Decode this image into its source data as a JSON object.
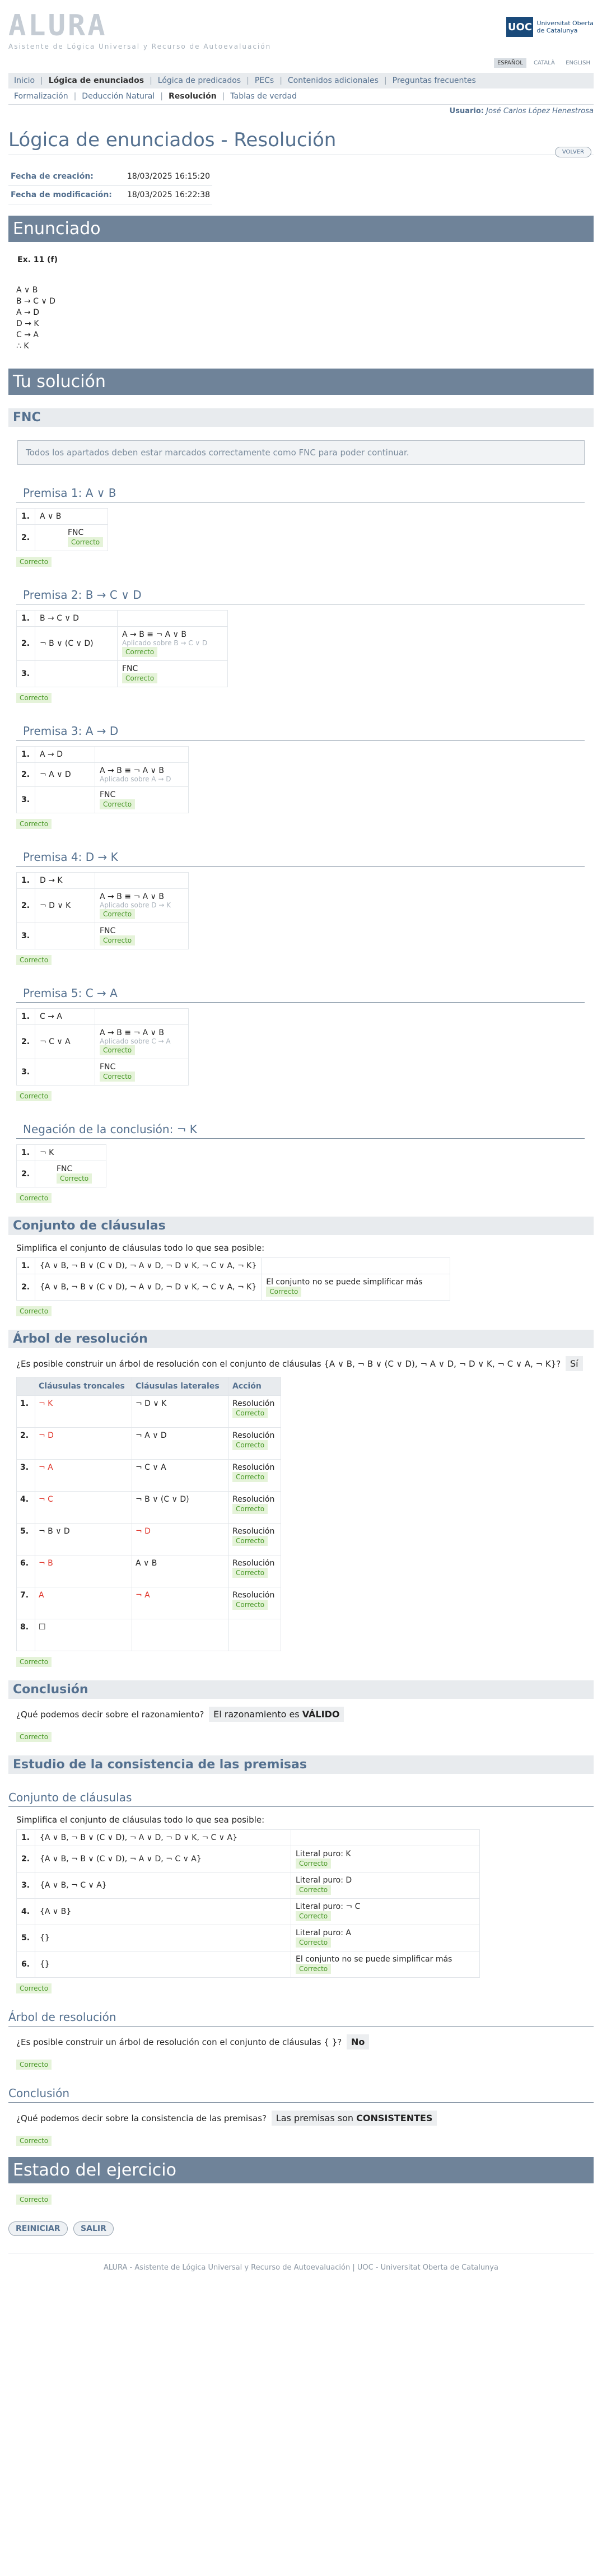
{
  "header": {
    "logo": "ALURA",
    "tagline": "Asistente de Lógica Universal y Recurso de Autoevaluación",
    "uoc_short": "UOC",
    "uoc_line1": "Universitat Oberta",
    "uoc_line2": "de Catalunya",
    "langs": [
      "ESPAÑOL",
      "CATALÀ",
      "ENGLISH"
    ]
  },
  "menu": [
    "Inicio",
    "Lógica de enunciados",
    "Lógica de predicados",
    "PECs",
    "Contenidos adicionales",
    "Preguntas frecuentes"
  ],
  "submenu": [
    "Formalización",
    "Deducción Natural",
    "Resolución",
    "Tablas de verdad"
  ],
  "user_label": "Usuario:",
  "user_name": "José Carlos López Henestrosa",
  "page_title": "Lógica de enunciados - Resolución",
  "volver": "VOLVER",
  "info": {
    "created_label": "Fecha de creación:",
    "created": "18/03/2025 16:15:20",
    "modified_label": "Fecha de modificación:",
    "modified": "18/03/2025 16:22:38"
  },
  "enunciado": {
    "title": "Enunciado",
    "ex": "Ex. 11 (f)",
    "premises": [
      "A ∨ B",
      "B → C ∨ D",
      "A → D",
      "D → K",
      "C → A"
    ],
    "conclusion": "∴ K"
  },
  "solucion_title": "Tu solución",
  "fnc": {
    "title": "FNC",
    "note": "Todos los apartados deben estar marcados correctamente como FNC para poder continuar.",
    "ok": "Correcto",
    "premise1": {
      "title": "Premisa 1: A ∨ B",
      "r1": "A ∨ B",
      "r2": "FNC"
    },
    "premise2": {
      "title": "Premisa 2: B → C ∨ D",
      "r1": "B → C ∨ D",
      "r2": "¬ B ∨ (C ∨ D)",
      "rule": "A → B ≡ ¬ A ∨ B",
      "applied": "Aplicado sobre B → C ∨ D",
      "r3": "FNC"
    },
    "premise3": {
      "title": "Premisa 3: A → D",
      "r1": "A → D",
      "r2": "¬ A ∨ D",
      "rule": "A → B ≡ ¬ A ∨ B",
      "applied": "Aplicado sobre A → D",
      "r3": "FNC"
    },
    "premise4": {
      "title": "Premisa 4: D → K",
      "r1": "D → K",
      "r2": "¬ D ∨ K",
      "rule": "A → B ≡ ¬ A ∨ B",
      "applied": "Aplicado sobre D → K",
      "r3": "FNC"
    },
    "premise5": {
      "title": "Premisa 5: C → A",
      "r1": "C → A",
      "r2": "¬ C ∨ A",
      "rule": "A → B ≡ ¬ A ∨ B",
      "applied": "Aplicado sobre C → A",
      "r3": "FNC"
    },
    "negation": {
      "title": "Negación de la conclusión: ¬ K",
      "r1": "¬ K",
      "r2": "FNC"
    }
  },
  "clausulas": {
    "title": "Conjunto de cláusulas",
    "text": "Simplifica el conjunto de cláusulas todo lo que sea posible:",
    "r1": "{A ∨ B, ¬ B ∨ (C ∨ D), ¬ A ∨ D, ¬ D ∨ K, ¬ C ∨ A, ¬ K}",
    "r2": "{A ∨ B, ¬ B ∨ (C ∨ D), ¬ A ∨ D, ¬ D ∨ K, ¬ C ∨ A, ¬ K}",
    "r2_note": "El conjunto no se puede simplificar más",
    "ok": "Correcto"
  },
  "arbol": {
    "title": "Árbol de resolución",
    "question": "¿Es posible construir un árbol de resolución con el conjunto de cláusulas {A ∨ B, ¬ B ∨ (C ∨ D), ¬ A ∨ D, ¬ D ∨ K, ¬ C ∨ A, ¬ K}?",
    "answer": "Sí",
    "headers": [
      "Cláusulas troncales",
      "Cláusulas laterales",
      "Acción"
    ],
    "rows": [
      {
        "n": "1.",
        "t": "¬ K",
        "l": "¬ D ∨ K",
        "a": "Resolución"
      },
      {
        "n": "2.",
        "t": "¬ D",
        "l": "¬ A ∨ D",
        "a": "Resolución"
      },
      {
        "n": "3.",
        "t": "¬ A",
        "l": "¬ C ∨ A",
        "a": "Resolución"
      },
      {
        "n": "4.",
        "t": "¬ C",
        "l": "¬ B ∨ (C ∨ D)",
        "a": "Resolución"
      },
      {
        "n": "5.",
        "t": "¬ B ∨ D",
        "l": "¬ D",
        "a": "Resolución"
      },
      {
        "n": "6.",
        "t": "¬ B",
        "l": "A ∨ B",
        "a": "Resolución"
      },
      {
        "n": "7.",
        "t": "A",
        "l": "¬ A",
        "a": "Resolución"
      },
      {
        "n": "8.",
        "t": "☐",
        "l": "",
        "a": ""
      }
    ],
    "ok": "Correcto"
  },
  "conclusion": {
    "title": "Conclusión",
    "question": "¿Qué podemos decir sobre el razonamiento?",
    "answer_pre": "El razonamiento es",
    "answer_bold": "VÁLIDO",
    "ok": "Correcto"
  },
  "consistencia": {
    "title": "Estudio de la consistencia de las premisas",
    "clausulas_title": "Conjunto de cláusulas",
    "text": "Simplifica el conjunto de cláusulas todo lo que sea posible:",
    "rows": [
      {
        "n": "1.",
        "v": "{A ∨ B, ¬ B ∨ (C ∨ D), ¬ A ∨ D, ¬ D ∨ K, ¬ C ∨ A}",
        "note": ""
      },
      {
        "n": "2.",
        "v": "{A ∨ B, ¬ B ∨ (C ∨ D), ¬ A ∨ D, ¬ C ∨ A}",
        "note": "Literal puro: K"
      },
      {
        "n": "3.",
        "v": "{A ∨ B, ¬ C ∨ A}",
        "note": "Literal puro: D"
      },
      {
        "n": "4.",
        "v": "{A ∨ B}",
        "note": "Literal puro: ¬ C"
      },
      {
        "n": "5.",
        "v": "{}",
        "note": "Literal puro: A"
      },
      {
        "n": "6.",
        "v": "{}",
        "note": "El conjunto no se puede simplificar más"
      }
    ],
    "ok": "Correcto",
    "arbol_title": "Árbol de resolución",
    "arbol_question": "¿Es posible construir un árbol de resolución con el conjunto de cláusulas { }?",
    "arbol_answer": "No",
    "concl_title": "Conclusión",
    "concl_question": "¿Qué podemos decir sobre la consistencia de las premisas?",
    "concl_answer_pre": "Las premisas son",
    "concl_answer_bold": "CONSISTENTES"
  },
  "estado": {
    "title": "Estado del ejercicio",
    "ok": "Correcto"
  },
  "buttons": {
    "reiniciar": "REINICIAR",
    "salir": "SALIR"
  },
  "footer": "ALURA - Asistente de Lógica Universal y Recurso de Autoevaluación | UOC - Universitat Oberta de Catalunya"
}
